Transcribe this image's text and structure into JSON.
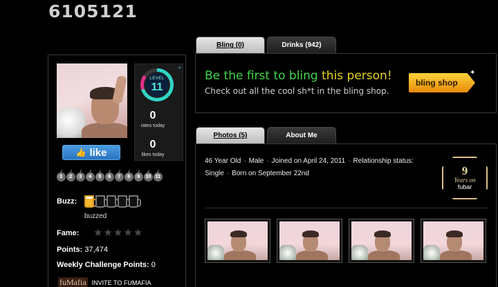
{
  "profile": {
    "username": "6105121",
    "level_label": "LEVEL",
    "level": "11",
    "rates_today": "0",
    "rates_today_label": "rates today",
    "likes_today": "0",
    "likes_today_label": "likes today",
    "like_label": "like",
    "level_badges": [
      "1",
      "2",
      "3",
      "4",
      "5",
      "6",
      "7",
      "8",
      "9",
      "10",
      "11"
    ],
    "buzz_label": "Buzz:",
    "buzz_level": 1,
    "buzz_max": 5,
    "buzz_status": "buzzed",
    "fame_label": "Fame:",
    "fame_stars": 0,
    "fame_max": 5,
    "points_label": "Points:",
    "points_value": "37,474",
    "weekly_label": "Weekly Challenge Points:",
    "weekly_value": "0",
    "fumafia_logo": "fuMafia",
    "fumafia_invite": "INVITE TO FUMAFIA"
  },
  "tabs_top": [
    {
      "label": "Bling (0)",
      "active": true
    },
    {
      "label": "Drinks (942)",
      "active": false
    }
  ],
  "bling": {
    "title_green": "Be the first to bling",
    "title_yellow": " this person!",
    "subtitle": "Check out all the cool sh*t in the bling shop.",
    "shop_button": "bling shop"
  },
  "tabs_bottom": [
    {
      "label": "Photos (5)",
      "active": true
    },
    {
      "label": "About Me",
      "active": false
    }
  ],
  "about": {
    "age": "46 Year Old",
    "gender": "Male",
    "joined": "Joined on April 24, 2011",
    "relationship": "Relationship status: Single",
    "born": "Born on September 22nd"
  },
  "years_badge": {
    "number": "9",
    "text": "Years on",
    "site": "fubar"
  },
  "photo_count_visible": 4,
  "colors": {
    "accent_green": "#3fd64a",
    "accent_yellow": "#e8d22a",
    "like_blue": "#2a74c0",
    "badge_gold": "#d8c08a"
  }
}
